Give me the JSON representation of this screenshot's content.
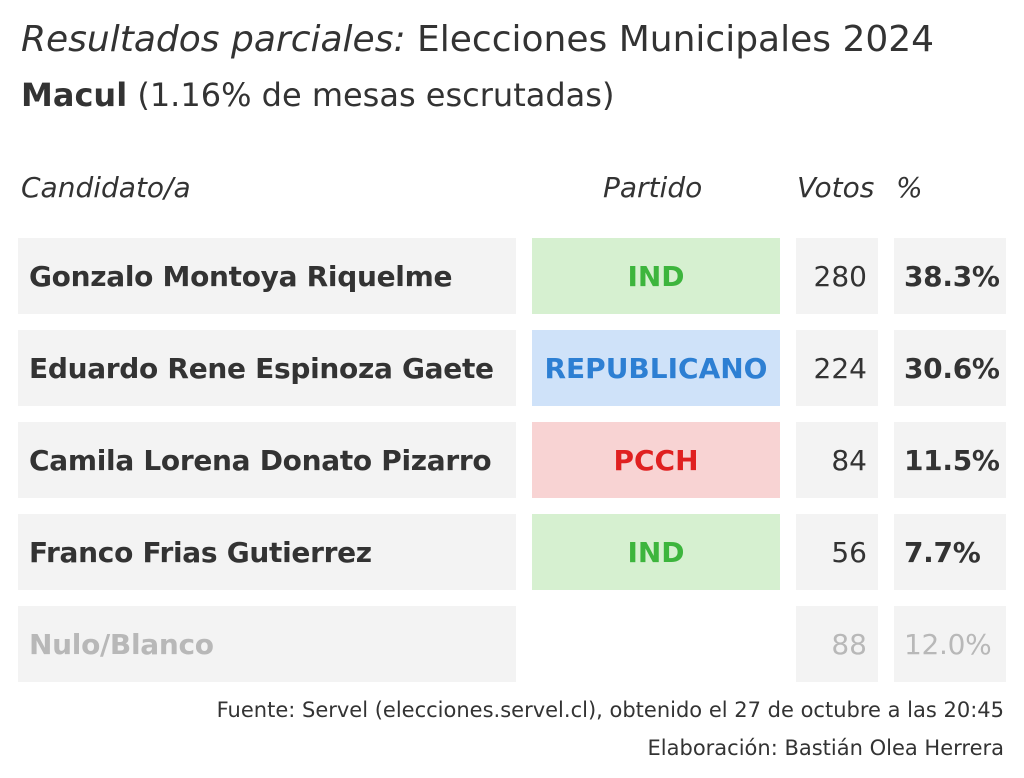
{
  "title": {
    "italic": "Resultados parciales:",
    "rest": " Elecciones Municipales 2024"
  },
  "subtitle": {
    "bold": "Macul",
    "rest": " (1.16% de mesas escrutadas)"
  },
  "headers": {
    "candidate": "Candidato/a",
    "party": "Partido",
    "votes": "Votos",
    "pct": "%"
  },
  "parties": {
    "IND": {
      "bg": "#d6f0d0",
      "fg": "#3db53d"
    },
    "REPUBLICANO": {
      "bg": "#cfe2f9",
      "fg": "#2d7fd3"
    },
    "PCCH": {
      "bg": "#f8d3d3",
      "fg": "#e02020"
    }
  },
  "chart_data": {
    "type": "table",
    "columns": [
      "Candidato/a",
      "Partido",
      "Votos",
      "%"
    ],
    "rows": [
      {
        "name": "Gonzalo Montoya Riquelme",
        "party": "IND",
        "votes": "280",
        "pct": "38.3%"
      },
      {
        "name": "Eduardo Rene Espinoza Gaete",
        "party": "REPUBLICANO",
        "votes": "224",
        "pct": "30.6%"
      },
      {
        "name": "Camila Lorena Donato Pizarro",
        "party": "PCCH",
        "votes": "84",
        "pct": "11.5%"
      },
      {
        "name": "Franco Frias Gutierrez",
        "party": "IND",
        "votes": "56",
        "pct": "7.7%"
      },
      {
        "name": "Nulo/Blanco",
        "party": "",
        "votes": "88",
        "pct": "12.0%",
        "muted": true
      }
    ]
  },
  "footer": {
    "source": "Fuente: Servel (elecciones.servel.cl), obtenido el 27 de octubre a las 20:45",
    "credit": "Elaboración: Bastián Olea Herrera"
  }
}
